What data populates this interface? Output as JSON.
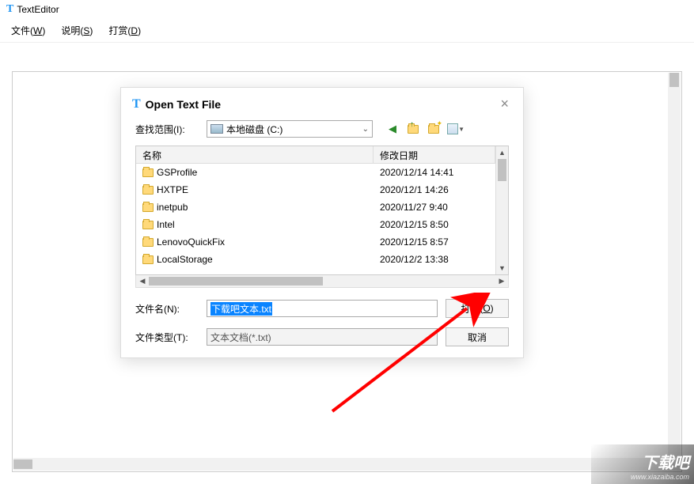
{
  "app": {
    "title": "TextEditor"
  },
  "menubar": {
    "file": {
      "label": "文件",
      "accel": "W"
    },
    "help": {
      "label": "说明",
      "accel": "S"
    },
    "donate": {
      "label": "打赏",
      "accel": "D"
    }
  },
  "dialog": {
    "title": "Open Text File",
    "close": "×",
    "lookin_label": "查找范围(I):",
    "drive": "本地磁盘 (C:)",
    "columns": {
      "name": "名称",
      "date": "修改日期"
    },
    "items": [
      {
        "name": "GSProfile",
        "date": "2020/12/14 14:41"
      },
      {
        "name": "HXTPE",
        "date": "2020/12/1 14:26"
      },
      {
        "name": "inetpub",
        "date": "2020/11/27 9:40"
      },
      {
        "name": "Intel",
        "date": "2020/12/15 8:50"
      },
      {
        "name": "LenovoQuickFix",
        "date": "2020/12/15 8:57"
      },
      {
        "name": "LocalStorage",
        "date": "2020/12/2 13:38"
      }
    ],
    "filename_label": "文件名(N):",
    "filename_value": "下载吧文本.txt",
    "filetype_label": "文件类型(T):",
    "filetype_value": "文本文档(*.txt)",
    "open": {
      "label": "打开",
      "accel": "O"
    },
    "cancel": "取消"
  },
  "watermark": {
    "text": "下载吧",
    "url": "www.xiazaiba.com"
  }
}
